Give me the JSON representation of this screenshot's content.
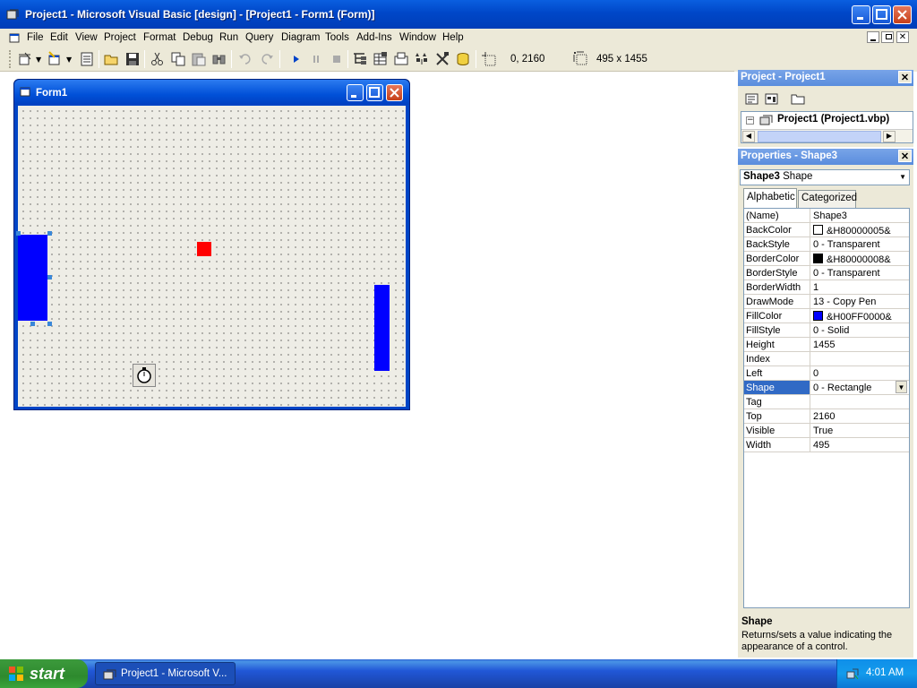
{
  "window": {
    "title": "Project1 - Microsoft Visual Basic [design] - [Project1 - Form1 (Form)]"
  },
  "menu": [
    "File",
    "Edit",
    "View",
    "Project",
    "Format",
    "Debug",
    "Run",
    "Query",
    "Diagram",
    "Tools",
    "Add-Ins",
    "Window",
    "Help"
  ],
  "toolbar": {
    "position": "0, 2160",
    "size": "495 x 1455"
  },
  "form": {
    "title": "Form1"
  },
  "project_panel": {
    "title": "Project - Project1",
    "tree_root": "Project1 (Project1.vbp)"
  },
  "properties_panel": {
    "title": "Properties - Shape3",
    "object_name": "Shape3",
    "object_type": "Shape",
    "tabs": [
      "Alphabetic",
      "Categorized"
    ],
    "rows": [
      {
        "name": "(Name)",
        "value": "Shape3"
      },
      {
        "name": "BackColor",
        "value": "&H80000005&",
        "swatch": "#ffffff"
      },
      {
        "name": "BackStyle",
        "value": "0 - Transparent"
      },
      {
        "name": "BorderColor",
        "value": "&H80000008&",
        "swatch": "#000000"
      },
      {
        "name": "BorderStyle",
        "value": "0 - Transparent"
      },
      {
        "name": "BorderWidth",
        "value": "1"
      },
      {
        "name": "DrawMode",
        "value": "13 - Copy Pen"
      },
      {
        "name": "FillColor",
        "value": "&H00FF0000&",
        "swatch": "#0000ff"
      },
      {
        "name": "FillStyle",
        "value": "0 - Solid"
      },
      {
        "name": "Height",
        "value": "1455"
      },
      {
        "name": "Index",
        "value": ""
      },
      {
        "name": "Left",
        "value": "0"
      },
      {
        "name": "Shape",
        "value": "0 - Rectangle",
        "selected": true
      },
      {
        "name": "Tag",
        "value": ""
      },
      {
        "name": "Top",
        "value": "2160"
      },
      {
        "name": "Visible",
        "value": "True"
      },
      {
        "name": "Width",
        "value": "495"
      }
    ],
    "description_title": "Shape",
    "description_text": "Returns/sets a value indicating the appearance of a control."
  },
  "taskbar": {
    "start": "start",
    "task": "Project1 - Microsoft V...",
    "clock": "4:01 AM"
  },
  "colors": {
    "shape_fill": "#0000ff",
    "timer_box": "#ff0000",
    "selection": "#316ac5"
  }
}
